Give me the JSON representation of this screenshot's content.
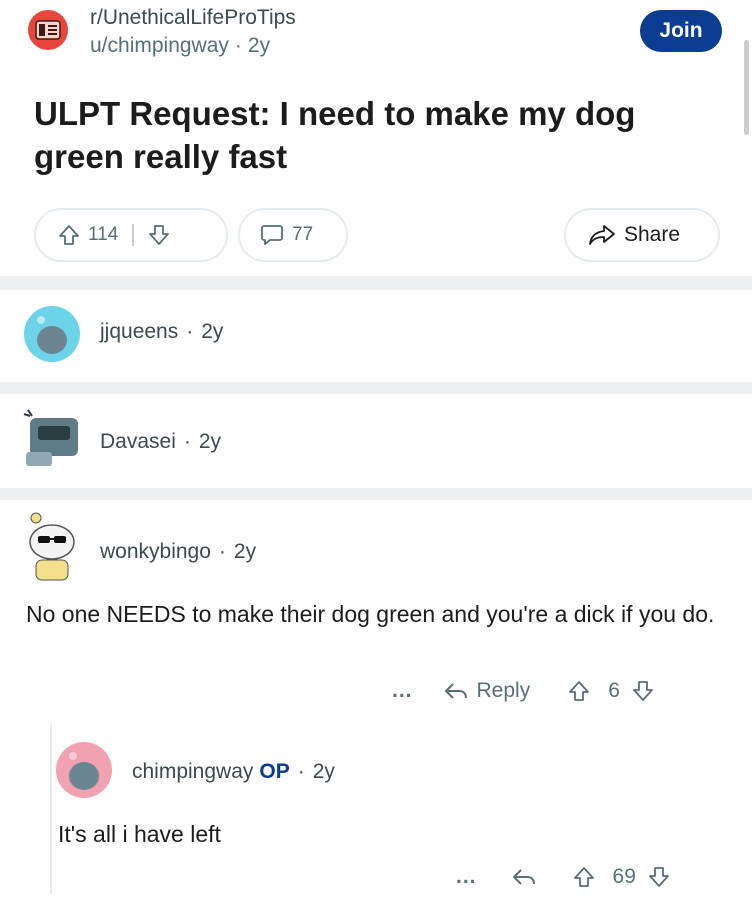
{
  "post": {
    "subreddit": "r/UnethicalLifeProTips",
    "author": "u/chimpingway",
    "age": "2y",
    "join_label": "Join",
    "title": "ULPT Request: I need to make my dog green really fast",
    "votes": "114",
    "comments": "77",
    "share_label": "Share"
  },
  "comments": [
    {
      "user": "jjqueens",
      "age": "2y"
    },
    {
      "user": "Davasei",
      "age": "2y"
    },
    {
      "user": "wonkybingo",
      "age": "2y",
      "text": "No one NEEDS to make their dog green and you're a dick if you do.",
      "reply_label": "Reply",
      "votes": "6"
    },
    {
      "user": "chimpingway",
      "op_label": "OP",
      "age": "2y",
      "text": "It's all i have left",
      "votes": "69"
    }
  ],
  "ui": {
    "more_label": "...",
    "dot": "·"
  }
}
